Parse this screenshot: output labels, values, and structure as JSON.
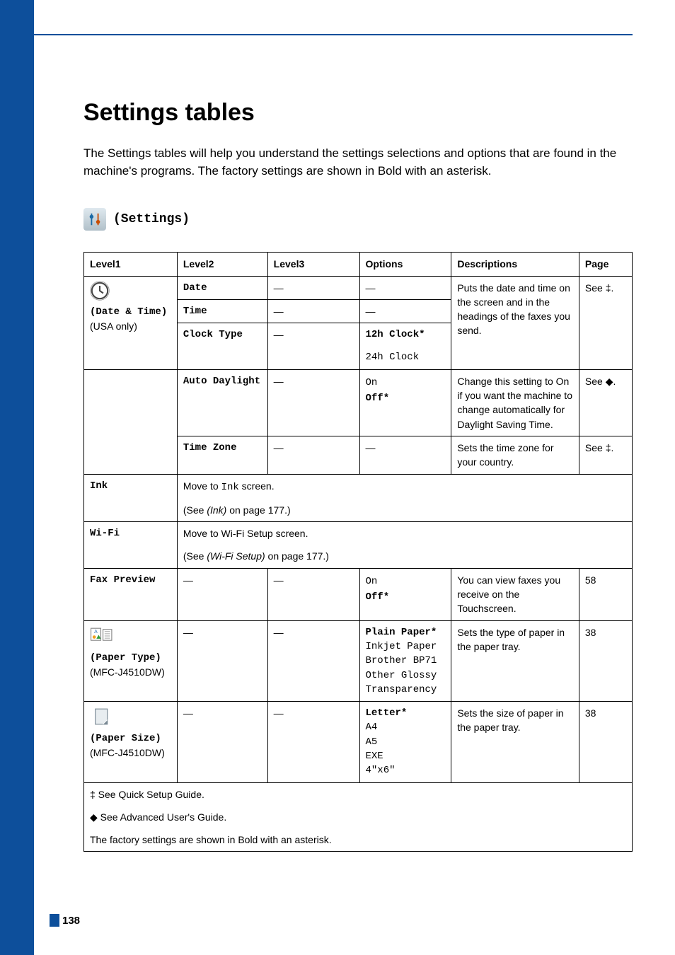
{
  "page": {
    "title": "Settings tables",
    "intro": "The Settings tables will help you understand the settings selections and options that are found in the machine's programs. The factory settings are shown in Bold with an asterisk.",
    "number": "138"
  },
  "settings_head": "(Settings)",
  "headers": {
    "l1": "Level1",
    "l2": "Level2",
    "l3": "Level3",
    "opt": "Options",
    "desc": "Descriptions",
    "pg": "Page"
  },
  "datetime": {
    "label": "(Date & Time)",
    "usa": "(USA only)",
    "date": {
      "l2": "Date",
      "l3": "—",
      "opt": "—"
    },
    "time": {
      "l2": "Time",
      "l3": "—",
      "opt": "—"
    },
    "clock": {
      "l2": "Clock Type",
      "l3": "—",
      "opt1": "12h Clock*",
      "opt2": "24h Clock"
    },
    "desc": "Puts the date and time on the screen and in the headings of the faxes you send.",
    "pg": "See ‡.",
    "auto": {
      "l2": "Auto Daylight",
      "l3": "—",
      "opt1": "On",
      "opt2": "Off*",
      "desc": "Change this setting to On if you want the machine to change automatically for Daylight Saving Time.",
      "pg": "See ◆."
    },
    "tz": {
      "l2": "Time Zone",
      "l3": "—",
      "opt": "—",
      "desc": "Sets the time zone for your country.",
      "pg": "See ‡."
    }
  },
  "ink": {
    "l1": "Ink",
    "line1a": "Move to ",
    "line1b": "Ink",
    "line1c": " screen.",
    "line2a": "(See ",
    "line2b": "(Ink)",
    "line2c": " on page 177.)"
  },
  "wifi": {
    "l1": "Wi-Fi",
    "line1": "Move to Wi-Fi Setup screen.",
    "line2a": "(See ",
    "line2b": "(Wi-Fi Setup)",
    "line2c": " on page 177.)"
  },
  "fax": {
    "l1": "Fax Preview",
    "l2": "—",
    "l3": "—",
    "opt1": "On",
    "opt2": "Off*",
    "desc": "You can view faxes you receive on the Touchscreen.",
    "pg": "58"
  },
  "ptype": {
    "label": "(Paper Type)",
    "model": "(MFC-J4510DW)",
    "l2": "—",
    "l3": "—",
    "opts": [
      "Plain Paper*",
      "Inkjet Paper",
      "Brother BP71",
      "Other Glossy",
      "Transparency"
    ],
    "desc": "Sets the type of paper in the paper tray.",
    "pg": "38"
  },
  "psize": {
    "label": "(Paper Size)",
    "model": "(MFC-J4510DW)",
    "l2": "—",
    "l3": "—",
    "opts": [
      "Letter*",
      "A4",
      "A5",
      "EXE",
      "4\"x6\""
    ],
    "desc": "Sets the size of paper in the paper tray.",
    "pg": "38"
  },
  "footnotes": {
    "a": "‡ See Quick Setup Guide.",
    "b": "◆ See Advanced User's Guide.",
    "c": "The factory settings are shown in Bold with an asterisk."
  }
}
